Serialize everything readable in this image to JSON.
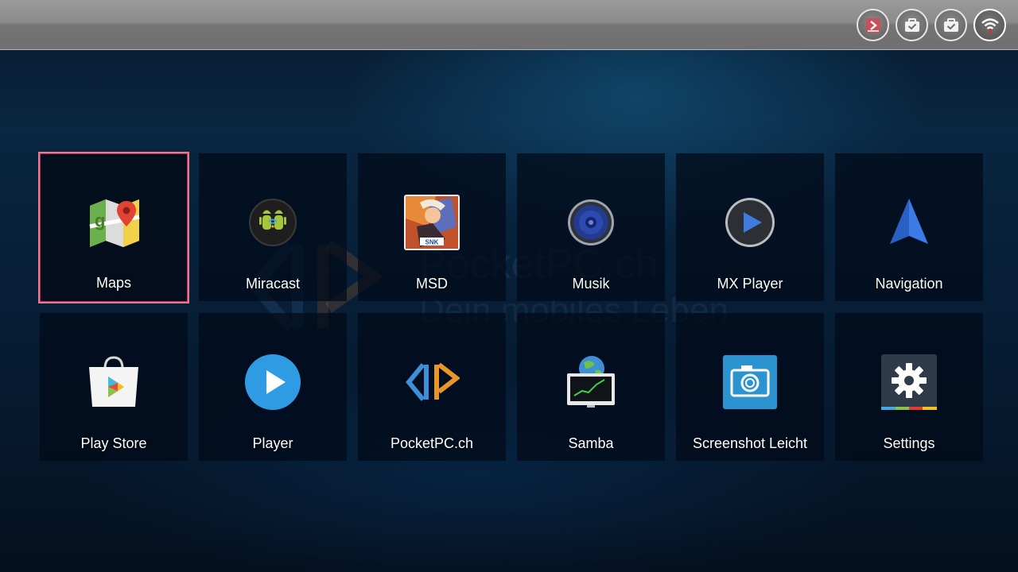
{
  "status_bar": {
    "icons": [
      "app-notification-icon",
      "briefcase-check-icon",
      "briefcase-check-icon",
      "wifi-icon"
    ]
  },
  "watermark": {
    "line1": "PocketPC.ch",
    "line2": "Dein mobiles Leben"
  },
  "apps": [
    {
      "label": "Maps",
      "icon": "maps-icon",
      "focused": true
    },
    {
      "label": "Miracast",
      "icon": "miracast-icon"
    },
    {
      "label": "MSD",
      "icon": "msd-icon"
    },
    {
      "label": "Musik",
      "icon": "speaker-icon"
    },
    {
      "label": "MX Player",
      "icon": "mx-player-icon"
    },
    {
      "label": "Navigation",
      "icon": "navigation-arrow-icon"
    },
    {
      "label": "Play Store",
      "icon": "play-store-icon"
    },
    {
      "label": "Player",
      "icon": "play-circle-icon"
    },
    {
      "label": "PocketPC.ch",
      "icon": "pocketpc-logo-icon"
    },
    {
      "label": "Samba",
      "icon": "samba-monitor-icon"
    },
    {
      "label": "Screenshot Leicht",
      "icon": "camera-icon"
    },
    {
      "label": "Settings",
      "icon": "gear-icon"
    }
  ],
  "colors": {
    "focus_border": "#e8778f",
    "tile_bg": "#020a18",
    "background": "#0a2640"
  }
}
